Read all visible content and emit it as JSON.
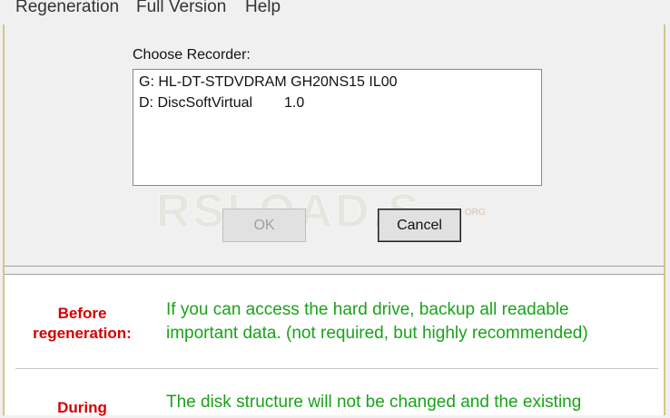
{
  "menu": [
    "Regeneration",
    "Full Version",
    "Help"
  ],
  "recorder": {
    "label": "Choose Recorder:",
    "items": [
      {
        "name": "G: HL-DT-STDVDRAM GH20NS15",
        "version": "IL00"
      },
      {
        "name": "D: DiscSoftVirtual",
        "version": "1.0"
      }
    ]
  },
  "buttons": {
    "ok": "OK",
    "cancel": "Cancel"
  },
  "watermark": {
    "text": "RSLOAD.S",
    "suffix": "ORG"
  },
  "info": {
    "before": {
      "heading_line1": "Before",
      "heading_line2": "regeneration:",
      "line1": "If you can access the hard drive, backup all readable",
      "line2": "important data. (not required, but highly recommended)"
    },
    "during": {
      "heading": "During",
      "line1": "The disk structure will not be changed and the existing"
    }
  },
  "colors": {
    "heading": "#d40000",
    "text": "#19a319"
  }
}
